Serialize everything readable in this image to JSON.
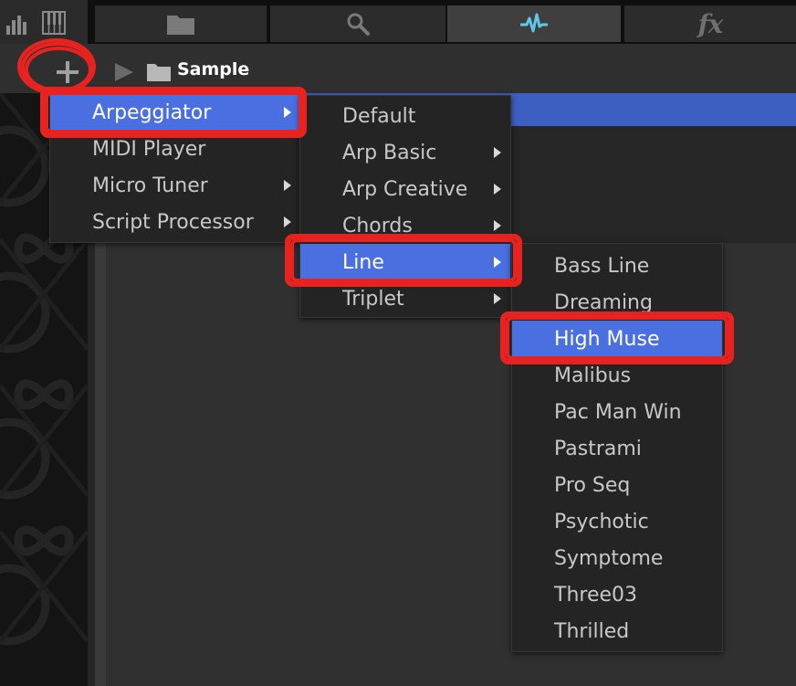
{
  "tabs": {
    "fx_label": "fx"
  },
  "path": {
    "label": "Sample"
  },
  "menu_level1": {
    "items": [
      {
        "label": "Arpeggiator",
        "selected": true,
        "submenu": true
      },
      {
        "label": "MIDI Player",
        "selected": false,
        "submenu": false
      },
      {
        "label": "Micro Tuner",
        "selected": false,
        "submenu": true
      },
      {
        "label": "Script Processor",
        "selected": false,
        "submenu": true
      }
    ]
  },
  "menu_level2": {
    "items": [
      {
        "label": "Default",
        "selected": false,
        "submenu": false
      },
      {
        "label": "Arp Basic",
        "selected": false,
        "submenu": true
      },
      {
        "label": "Arp Creative",
        "selected": false,
        "submenu": true
      },
      {
        "label": "Chords",
        "selected": false,
        "submenu": true
      },
      {
        "label": "Line",
        "selected": true,
        "submenu": true
      },
      {
        "label": "Triplet",
        "selected": false,
        "submenu": true
      }
    ]
  },
  "menu_level3": {
    "items": [
      {
        "label": "Bass Line",
        "selected": false
      },
      {
        "label": "Dreaming",
        "selected": false
      },
      {
        "label": "High Muse",
        "selected": true
      },
      {
        "label": "Malibus",
        "selected": false
      },
      {
        "label": "Pac Man Win",
        "selected": false
      },
      {
        "label": "Pastrami",
        "selected": false
      },
      {
        "label": "Pro Seq",
        "selected": false
      },
      {
        "label": "Psychotic",
        "selected": false
      },
      {
        "label": "Symptome",
        "selected": false
      },
      {
        "label": "Three03",
        "selected": false
      },
      {
        "label": "Thrilled",
        "selected": false
      }
    ]
  },
  "colors": {
    "selection": "#4a6fe0",
    "highlight_marker": "#e8231f",
    "waveform_accent": "#5fc8e8",
    "header_blue": "#3e5fc2"
  }
}
